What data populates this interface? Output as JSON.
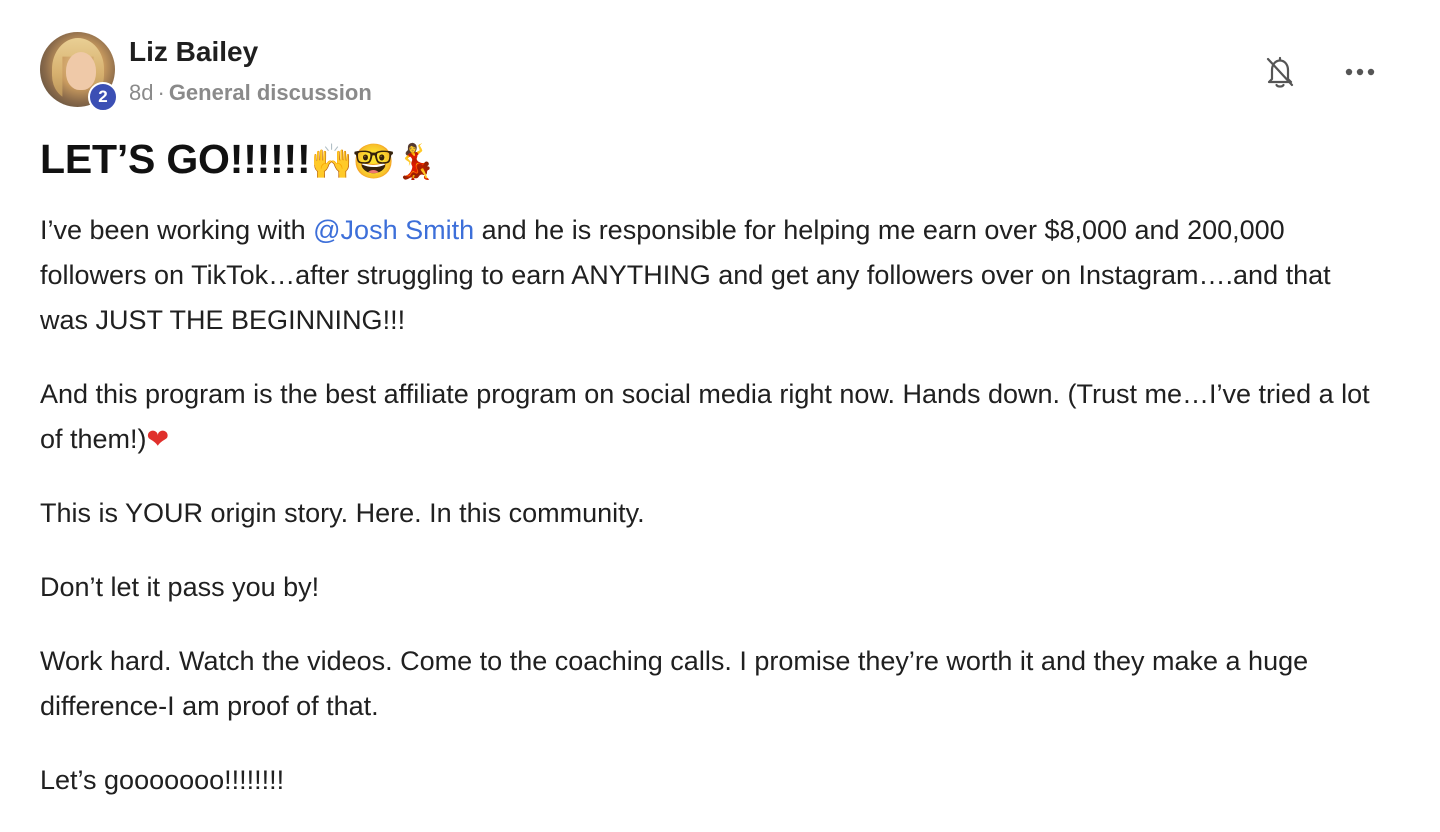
{
  "author": {
    "name": "Liz Bailey",
    "level": "2",
    "avatar_icon": "profile-photo"
  },
  "meta": {
    "age": "8d",
    "separator": "·",
    "category": "General discussion"
  },
  "actions": {
    "bell_icon": "bell-off-icon",
    "more_icon": "more-horizontal-icon"
  },
  "post": {
    "title": "LET’S GO!!!!!!",
    "title_emojis": "🙌🤓💃",
    "p1_before": "I’ve been working with ",
    "p1_mention": "@Josh Smith",
    "p1_after": " and he is responsible for helping me earn over $8,000 and 200,000 followers on TikTok…after struggling to earn ANYTHING and get any followers over on Instagram….and that was JUST THE BEGINNING!!!",
    "p2": "And this program is the best affiliate program on social media right now. Hands down. (Trust me…I’ve tried a lot of them!)",
    "p2_emoji": "❤",
    "p3": "This is YOUR origin story. Here. In this community.",
    "p4": "Don’t let it pass you by!",
    "p5": "Work hard. Watch the videos. Come to the coaching calls. I promise they’re worth it and they make a huge difference-I am proof of that.",
    "p6": "Let’s gooooooo!!!!!!!!"
  },
  "colors": {
    "mention": "#3d6fd9",
    "badge": "#3b4fb4",
    "meta_text": "#8a8a8a"
  }
}
